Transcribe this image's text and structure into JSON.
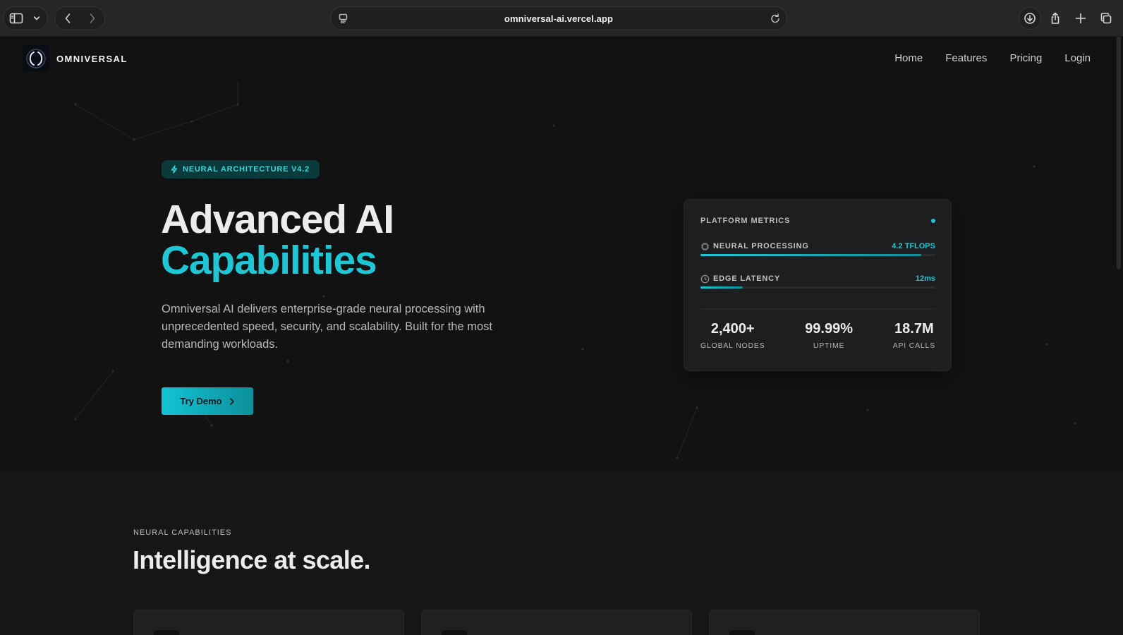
{
  "browser": {
    "url": "omniversal-ai.vercel.app"
  },
  "nav": {
    "brand": "OMNIVERSAL",
    "links": [
      "Home",
      "Features",
      "Pricing",
      "Login"
    ]
  },
  "hero": {
    "badge": "NEURAL ARCHITECTURE V4.2",
    "title_line1": "Advanced AI",
    "title_line2": "Capabilities",
    "description": "Omniversal AI delivers enterprise-grade neural processing with unprecedented speed, security, and scalability. Built for the most demanding workloads.",
    "cta_label": "Try Demo"
  },
  "metrics": {
    "title": "PLATFORM METRICS",
    "rows": [
      {
        "label": "NEURAL PROCESSING",
        "value": "4.2 TFLOPS",
        "level": 0.94
      },
      {
        "label": "EDGE LATENCY",
        "value": "12ms",
        "level": 0.18
      }
    ],
    "stats": [
      {
        "value": "2,400+",
        "label": "GLOBAL NODES"
      },
      {
        "value": "99.99%",
        "label": "UPTIME"
      },
      {
        "value": "18.7M",
        "label": "API CALLS"
      }
    ]
  },
  "capabilities": {
    "eyebrow": "NEURAL CAPABILITIES",
    "title": "Intelligence at scale."
  },
  "colors": {
    "accent": "#1ec6d6",
    "background": "#131313",
    "card": "#1d1e1f"
  }
}
